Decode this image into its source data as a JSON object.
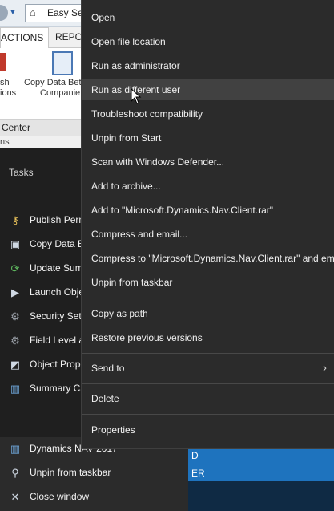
{
  "app": {
    "address_text": "Easy Sec",
    "ribbon_tabs": [
      "ACTIONS",
      "REPOR"
    ],
    "ribbon_buttons": [
      {
        "line1": "sh",
        "line2": "ions"
      },
      {
        "line1": "Copy Data Betw",
        "line2": "Companie"
      }
    ],
    "center_text": "Center",
    "sub_text": "ns"
  },
  "jumplist": {
    "tasks_header": "Tasks",
    "tasks": [
      {
        "label": "Publish Perm",
        "icon": "key-icon"
      },
      {
        "label": "Copy Data Be",
        "icon": "copy-data-icon"
      },
      {
        "label": "Update Summ",
        "icon": "refresh-icon"
      },
      {
        "label": "Launch Objec",
        "icon": "play-icon"
      },
      {
        "label": "Security Setu",
        "icon": "gears-icon"
      },
      {
        "label": "Field Level an",
        "icon": "gears-icon"
      },
      {
        "label": "Object Prope",
        "icon": "object-properties-icon"
      },
      {
        "label": "Summary Ca",
        "icon": "chart-icon"
      }
    ],
    "pinned": [
      {
        "label": "Dynamics NAV 2017",
        "icon": "dynamics-nav-icon"
      },
      {
        "label": "Unpin from taskbar",
        "icon": "unpin-icon"
      },
      {
        "label": "Close window",
        "icon": "close-icon"
      }
    ]
  },
  "background": {
    "blue_text1": "D",
    "blue_text2": "ER"
  },
  "context_menu": {
    "items": [
      {
        "label": "Open"
      },
      {
        "label": "Open file location"
      },
      {
        "label": "Run as administrator"
      },
      {
        "label": "Run as different user",
        "hover": true
      },
      {
        "label": "Troubleshoot compatibility"
      },
      {
        "label": "Unpin from Start"
      },
      {
        "label": "Scan with Windows Defender..."
      },
      {
        "label": "Add to archive..."
      },
      {
        "label": "Add to \"Microsoft.Dynamics.Nav.Client.rar\""
      },
      {
        "label": "Compress and email..."
      },
      {
        "label": "Compress to \"Microsoft.Dynamics.Nav.Client.rar\" and email"
      },
      {
        "label": "Unpin from taskbar"
      },
      {
        "label": "Copy as path"
      },
      {
        "label": "Restore previous versions"
      },
      {
        "label": "Send to",
        "submenu": true
      },
      {
        "label": "Delete"
      },
      {
        "label": "Properties"
      }
    ]
  }
}
